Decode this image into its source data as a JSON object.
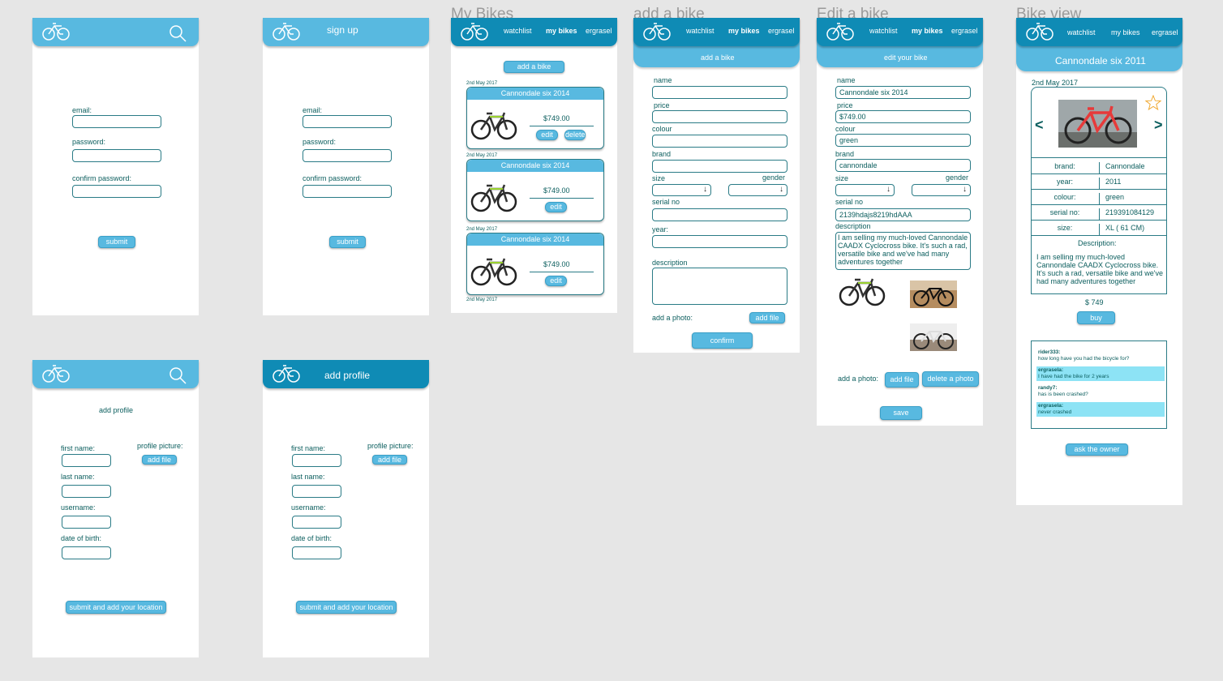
{
  "titles": {
    "my_bikes": "My Bikes",
    "add_bike": "add a bike",
    "edit_bike": "Edit a bike",
    "bike_view": "Bike view"
  },
  "nav": {
    "watchlist": "watchlist",
    "my_bikes": "my bikes",
    "user": "ergrasel"
  },
  "login": {
    "email": "email:",
    "password": "password:",
    "confirm": "confirm password:",
    "submit": "submit"
  },
  "signup": {
    "header": "sign up",
    "email": "email:",
    "password": "password:",
    "confirm": "confirm password:",
    "submit": "submit"
  },
  "profile": {
    "title": "add profile",
    "first": "first name:",
    "last": "last name:",
    "username": "username:",
    "dob": "date of birth:",
    "picture": "profile picture:",
    "add_file": "add file",
    "submit": "submit and add your location"
  },
  "mybikes": {
    "add": "add a bike",
    "cards": [
      {
        "date": "2nd May 2017",
        "title": "Cannondale six 2014",
        "price": "$749.00",
        "edit": "edit",
        "delete": "delete"
      },
      {
        "date": "2nd May 2017",
        "title": "Cannondale six 2014",
        "price": "$749.00",
        "edit": "edit"
      },
      {
        "date": "2nd May 2017",
        "title": "Cannondale six 2014",
        "price": "$749.00",
        "edit": "edit"
      }
    ],
    "last_date": "2nd May 2017"
  },
  "addbike": {
    "sub": "add a bike",
    "name": "name",
    "price": "price",
    "colour": "colour",
    "brand": "brand",
    "size": "size",
    "gender": "gender",
    "serial": "serial no",
    "year": "year:",
    "description": "description",
    "photo": "add a photo:",
    "add_file": "add file",
    "confirm": "confirm"
  },
  "editbike": {
    "sub": "edit your bike",
    "name": "name",
    "name_v": "Cannondale six 2014",
    "price": "price",
    "price_v": "$749.00",
    "colour": "colour",
    "colour_v": "green",
    "brand": "brand",
    "brand_v": "cannondale",
    "size": "size",
    "gender": "gender",
    "serial": "serial no",
    "serial_v": "2139hdajs8219hdAAA",
    "description": "description",
    "description_v": "I am selling my much-loved Cannondale CAADX Cyclocross bike. It's such a rad, versatile bike and we've had many adventures together",
    "photo": "add a photo:",
    "add_file": "add file",
    "delete_photo": "delete a photo",
    "save": "save"
  },
  "bikeview": {
    "sub": "Cannondale six 2011",
    "date": "2nd May 2017",
    "prev": "<",
    "next": ">",
    "rows": [
      {
        "k": "brand:",
        "v": "Cannondale"
      },
      {
        "k": "year:",
        "v": "2011"
      },
      {
        "k": "colour:",
        "v": "green"
      },
      {
        "k": "serial no:",
        "v": "219391084129"
      },
      {
        "k": "size:",
        "v": "XL ( 61 CM)"
      }
    ],
    "desc_label": "Description:",
    "desc": "I am selling my much-loved Cannondale CAADX Cyclocross bike. It's such a rad, versatile bike and we've had many adventures together",
    "price": "$ 749",
    "buy": "buy",
    "chat": [
      {
        "user": "rider333:",
        "msg": "how long have you had the bicycle for?",
        "hl": false
      },
      {
        "user": "ergrasela:",
        "msg": "I have had the bike for 2 years",
        "hl": true
      },
      {
        "user": "randy7:",
        "msg": "has is been crashed?",
        "hl": false
      },
      {
        "user": "ergrasela:",
        "msg": "never crashed",
        "hl": true
      }
    ],
    "ask": "ask the owner"
  },
  "colors": {
    "accent": "#58b9e0",
    "dark_header": "#0f8bb5",
    "text": "#0b5e5e",
    "highlight": "#8de3f5"
  }
}
